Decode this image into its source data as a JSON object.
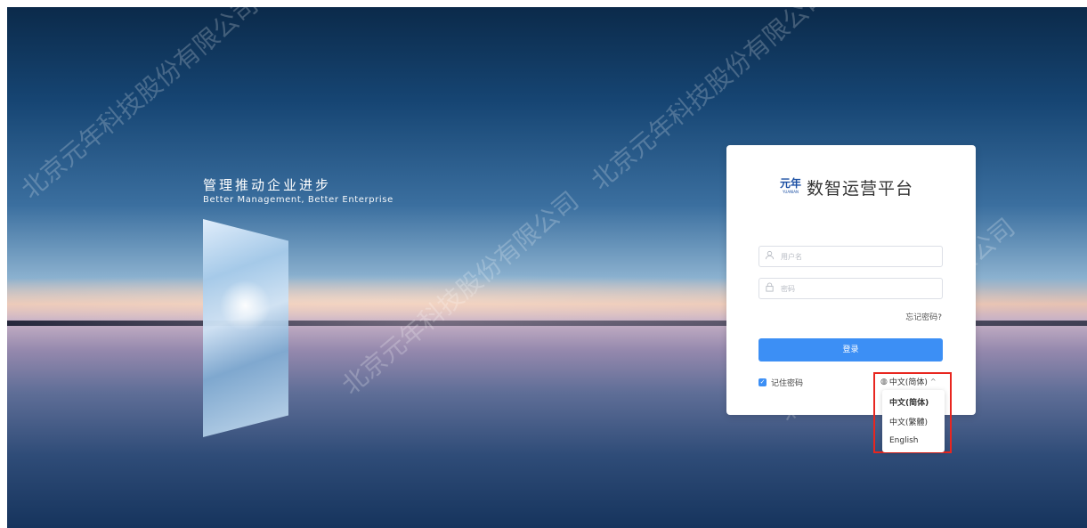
{
  "slogan": {
    "cn": "管理推动企业进步",
    "en": "Better Management, Better Enterprise"
  },
  "login": {
    "logo_cn": "元年",
    "logo_en": "YUANIAN",
    "title": "数智运营平台",
    "username_placeholder": "用户名",
    "password_placeholder": "密码",
    "forgot": "忘记密码?",
    "login_button": "登录",
    "remember": "记住密码"
  },
  "language": {
    "current": "中文(简体)",
    "options": [
      "中文(简体)",
      "中文(繁體)",
      "English"
    ],
    "selected_index": 0
  },
  "watermark_text": "北京元年科技股份有限公司",
  "colors": {
    "accent": "#3c8ff5",
    "highlight_border": "#e8261f"
  }
}
